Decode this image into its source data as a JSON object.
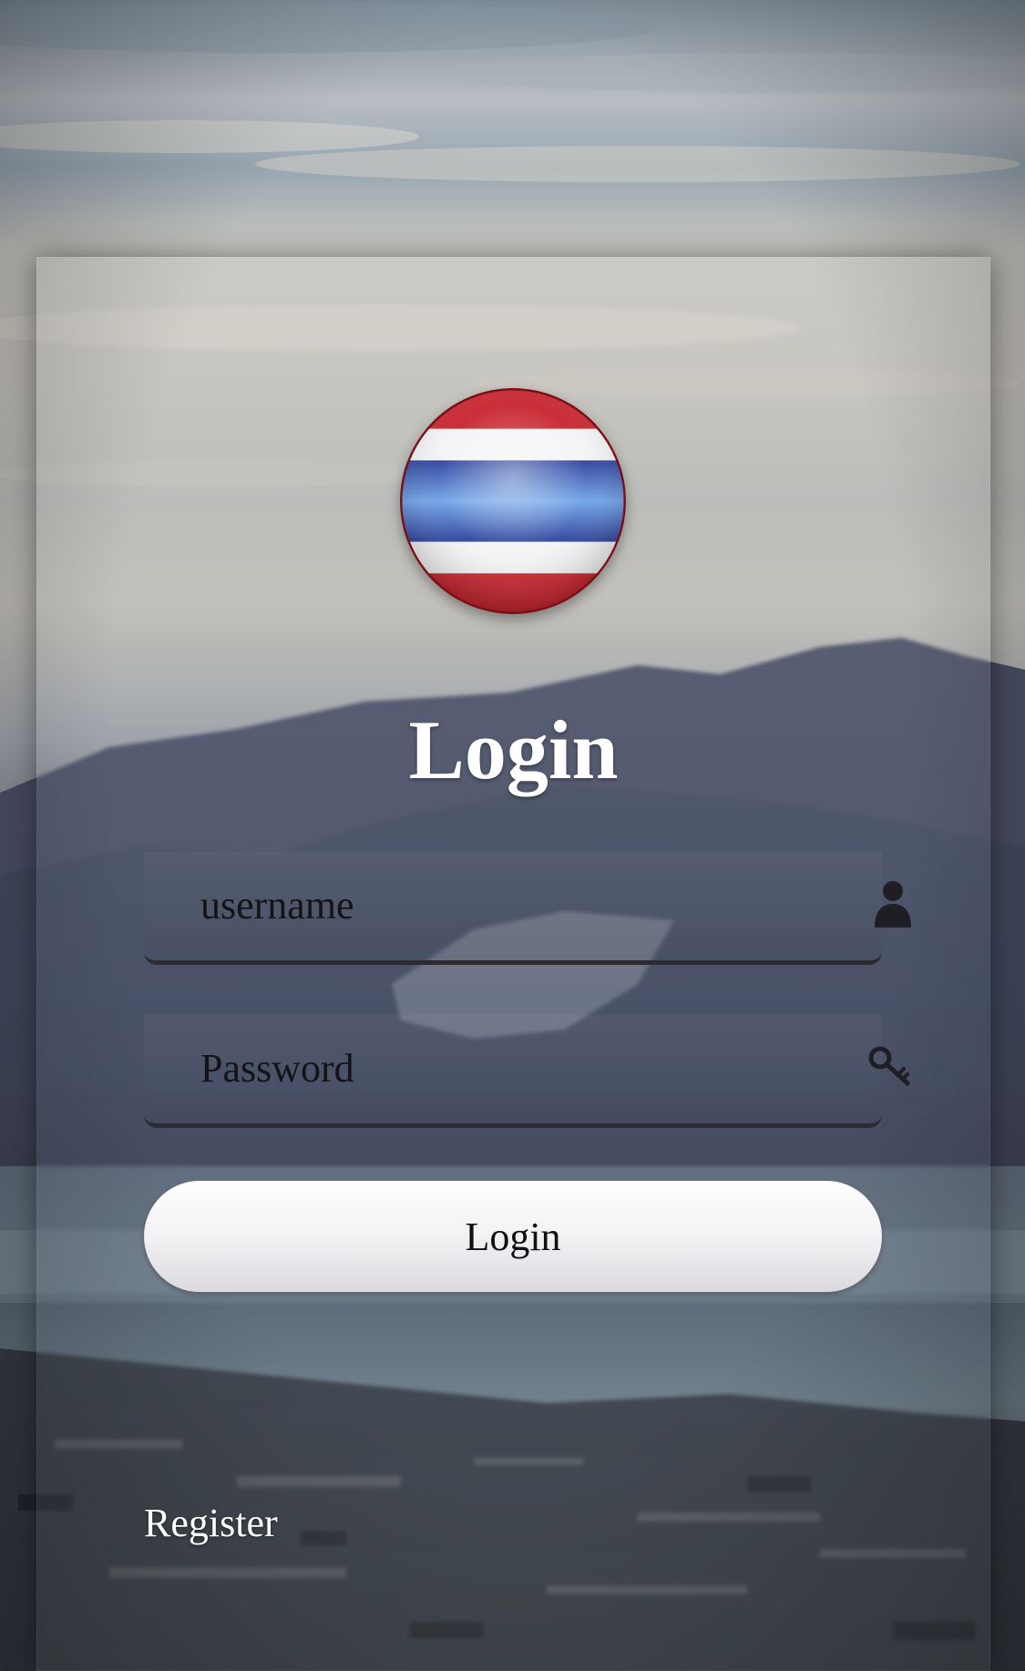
{
  "app": {
    "title": "Login"
  },
  "branding": {
    "flag_icon": "thailand-flag-icon",
    "colors": {
      "red": "#c8232d",
      "white": "#ffffff",
      "blue": "#2b3f9a"
    }
  },
  "form": {
    "username": {
      "placeholder": "username",
      "value": "",
      "icon": "user-icon"
    },
    "password": {
      "placeholder": "Password",
      "value": "",
      "icon": "key-icon"
    },
    "submit_label": "Login"
  },
  "footer": {
    "register_label": "Register"
  }
}
